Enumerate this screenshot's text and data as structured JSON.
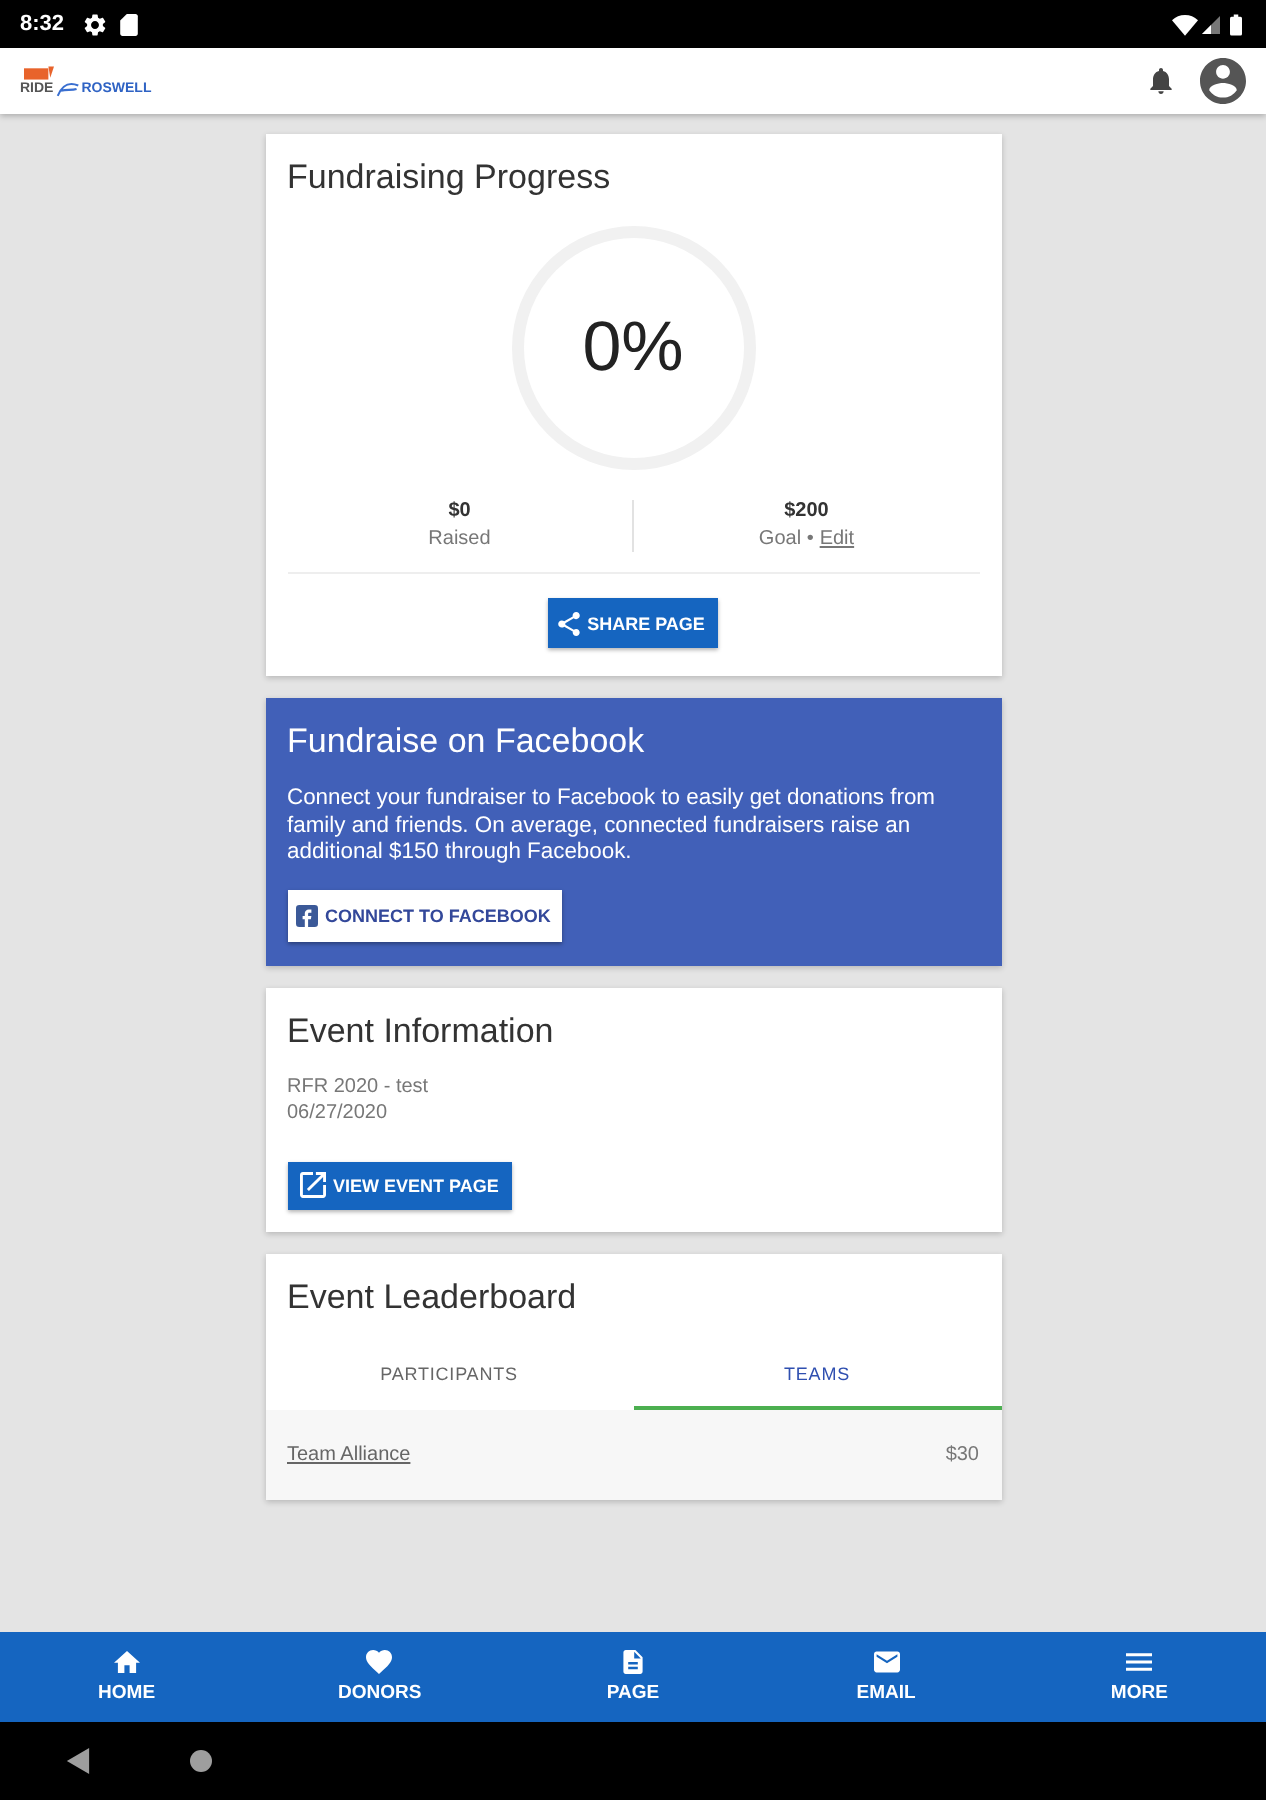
{
  "status_bar": {
    "time": "8:32"
  },
  "header": {
    "logo_words": [
      "RIDE",
      "ROSWELL"
    ]
  },
  "progress_card": {
    "title": "Fundraising Progress",
    "percent": "0%",
    "stats": [
      {
        "value": "$0",
        "label": "Raised"
      },
      {
        "value": "$200",
        "label": "Goal •",
        "link": "Edit"
      }
    ],
    "share_button": "SHARE PAGE"
  },
  "facebook_card": {
    "title": "Fundraise on Facebook",
    "text": "Connect your fundraiser to Facebook to easily get donations from family and friends. On average, connected fundraisers raise an additional $150 through Facebook.",
    "button": "CONNECT TO FACEBOOK"
  },
  "event_card": {
    "title": "Event Information",
    "lines": [
      "RFR 2020 - test",
      "06/27/2020"
    ],
    "button": "VIEW EVENT PAGE"
  },
  "leaderboard": {
    "title": "Event Leaderboard",
    "tabs": [
      {
        "label": "PARTICIPANTS",
        "selected": false
      },
      {
        "label": "TEAMS",
        "selected": true
      }
    ],
    "rows": [
      {
        "name": "Team Alliance",
        "amount": "$30"
      }
    ]
  },
  "bottom_nav": [
    {
      "label": "HOME"
    },
    {
      "label": "DONORS"
    },
    {
      "label": "PAGE"
    },
    {
      "label": "EMAIL"
    },
    {
      "label": "MORE"
    }
  ]
}
